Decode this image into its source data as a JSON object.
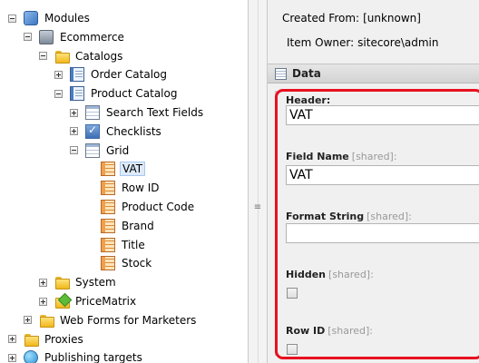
{
  "tree": {
    "items": [
      {
        "label": "Modules",
        "icon": "modules-icon",
        "expander": "minus"
      },
      {
        "label": "Ecommerce",
        "icon": "ecommerce-icon",
        "expander": "minus"
      },
      {
        "label": "Catalogs",
        "icon": "folder-icon",
        "expander": "minus"
      },
      {
        "label": "Order Catalog",
        "icon": "catalog-icon",
        "expander": "plus"
      },
      {
        "label": "Product Catalog",
        "icon": "catalog-icon",
        "expander": "minus"
      },
      {
        "label": "Search Text Fields",
        "icon": "table-icon",
        "expander": "plus"
      },
      {
        "label": "Checklists",
        "icon": "checklist-icon",
        "expander": "plus"
      },
      {
        "label": "Grid",
        "icon": "table-icon",
        "expander": "minus"
      },
      {
        "label": "VAT",
        "icon": "field-icon",
        "expander": "none",
        "selected": true
      },
      {
        "label": "Row ID",
        "icon": "field-icon",
        "expander": "none"
      },
      {
        "label": "Product Code",
        "icon": "field-icon",
        "expander": "none"
      },
      {
        "label": "Brand",
        "icon": "field-icon",
        "expander": "none"
      },
      {
        "label": "Title",
        "icon": "field-icon",
        "expander": "none"
      },
      {
        "label": "Stock",
        "icon": "field-icon",
        "expander": "none"
      },
      {
        "label": "System",
        "icon": "folder-icon",
        "expander": "plus"
      },
      {
        "label": "PriceMatrix",
        "icon": "pricematrix-icon",
        "expander": "plus"
      },
      {
        "label": "Web Forms for Marketers",
        "icon": "folder-icon",
        "expander": "plus"
      },
      {
        "label": "Proxies",
        "icon": "folder-icon",
        "expander": "plus"
      },
      {
        "label": "Publishing targets",
        "icon": "globe-icon",
        "expander": "plus"
      }
    ]
  },
  "splitter": {
    "grip_glyph": "≡"
  },
  "content": {
    "created_from_label": "Created From:",
    "created_from_value": "[unknown]",
    "item_owner_label": "Item Owner:",
    "item_owner_value": "sitecore\\admin",
    "section_title": "Data",
    "fields": [
      {
        "label": "Header:",
        "shared": "",
        "type": "text",
        "value": "VAT"
      },
      {
        "label": "Field Name",
        "shared": "[shared]:",
        "type": "text",
        "value": "VAT"
      },
      {
        "label": "Format String",
        "shared": "[shared]:",
        "type": "text",
        "value": ""
      },
      {
        "label": "Hidden",
        "shared": "[shared]:",
        "type": "checkbox",
        "checked": false
      },
      {
        "label": "Row ID",
        "shared": "[shared]:",
        "type": "checkbox",
        "checked": false
      }
    ]
  },
  "colors": {
    "highlight": "#e8101f",
    "selection": "#ddeafa"
  }
}
